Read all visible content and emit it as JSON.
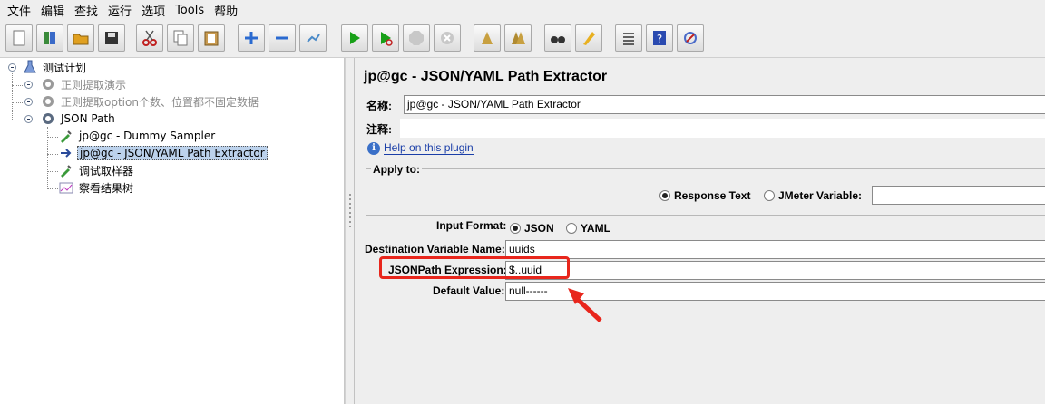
{
  "menu": [
    "文件",
    "编辑",
    "查找",
    "运行",
    "选项",
    "Tools",
    "帮助"
  ],
  "toolbar_icons": [
    "new-icon",
    "templates-icon",
    "open-icon",
    "save-icon",
    "cut-icon",
    "copy-icon",
    "paste-icon",
    "expand-icon",
    "collapse-icon",
    "toggle-icon",
    "start-icon",
    "start-no-pause-icon",
    "stop-icon",
    "shutdown-icon",
    "clear-icon",
    "clear-all-icon",
    "search-icon",
    "reset-search-icon",
    "function-helper-icon",
    "help-icon",
    "remote-icon"
  ],
  "tree": {
    "root": "测试计划",
    "items": [
      {
        "label": "正则提取演示",
        "disabled": true
      },
      {
        "label": "正则提取option个数、位置都不固定数据",
        "disabled": true
      },
      {
        "label": "JSON Path",
        "disabled": false
      },
      {
        "label": "jp@gc - Dummy Sampler"
      },
      {
        "label": "jp@gc - JSON/YAML Path Extractor",
        "selected": true
      },
      {
        "label": "调试取样器"
      },
      {
        "label": "察看结果树"
      }
    ]
  },
  "panel": {
    "title": "jp@gc - JSON/YAML Path Extractor",
    "name_label": "名称:",
    "name_value": "jp@gc - JSON/YAML Path Extractor",
    "comment_label": "注释:",
    "comment_value": "",
    "help_link": "Help on this plugin",
    "apply_to": {
      "label": "Apply to:",
      "response_text": "Response Text",
      "jmeter_variable": "JMeter Variable:",
      "selected": "Response Text",
      "variable_value": ""
    },
    "input_format": {
      "label": "Input Format:",
      "json": "JSON",
      "yaml": "YAML",
      "selected": "JSON"
    },
    "dest_var_label": "Destination Variable Name:",
    "dest_var_value": "uuids",
    "jsonpath_label": "JSONPath Expression:",
    "jsonpath_value": "$..uuid",
    "default_label": "Default Value:",
    "default_value": "null------"
  },
  "colors": {
    "highlight": "#e8261c",
    "selection": "#bcd2ec",
    "link": "#1a3ea8"
  }
}
